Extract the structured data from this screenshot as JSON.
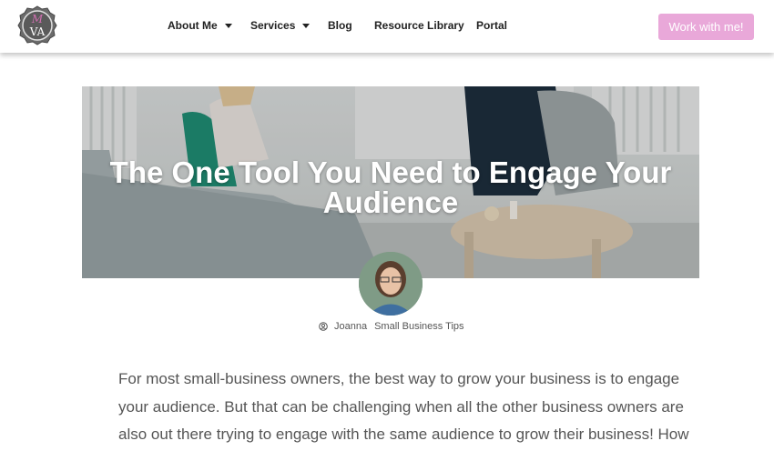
{
  "brand": {
    "logo_text": "VA",
    "logo_accent_letter": "M"
  },
  "nav": {
    "items": [
      {
        "label": "About Me",
        "has_dropdown": true
      },
      {
        "label": "Services",
        "has_dropdown": true
      },
      {
        "label": "Blog",
        "has_dropdown": false
      },
      {
        "label": "Resource Library",
        "has_dropdown": false
      },
      {
        "label": "Portal",
        "has_dropdown": false
      }
    ],
    "cta_label": "Work with me!"
  },
  "post": {
    "title_line1": "The One Tool You Need to Engage Your",
    "title_line2": "Audience",
    "author": "Joanna",
    "category": "Small Business Tips",
    "body_lines": [
      "For most small-business owners, the best way to grow your business is to engage",
      "your audience. But that can be challenging when all the other business owners are",
      "also out there trying to engage with the same audience to grow their business! How"
    ]
  },
  "colors": {
    "cta_background": "#e9a8d9",
    "logo_badge": "#5a5a5a",
    "logo_pink": "#d06fb0"
  }
}
